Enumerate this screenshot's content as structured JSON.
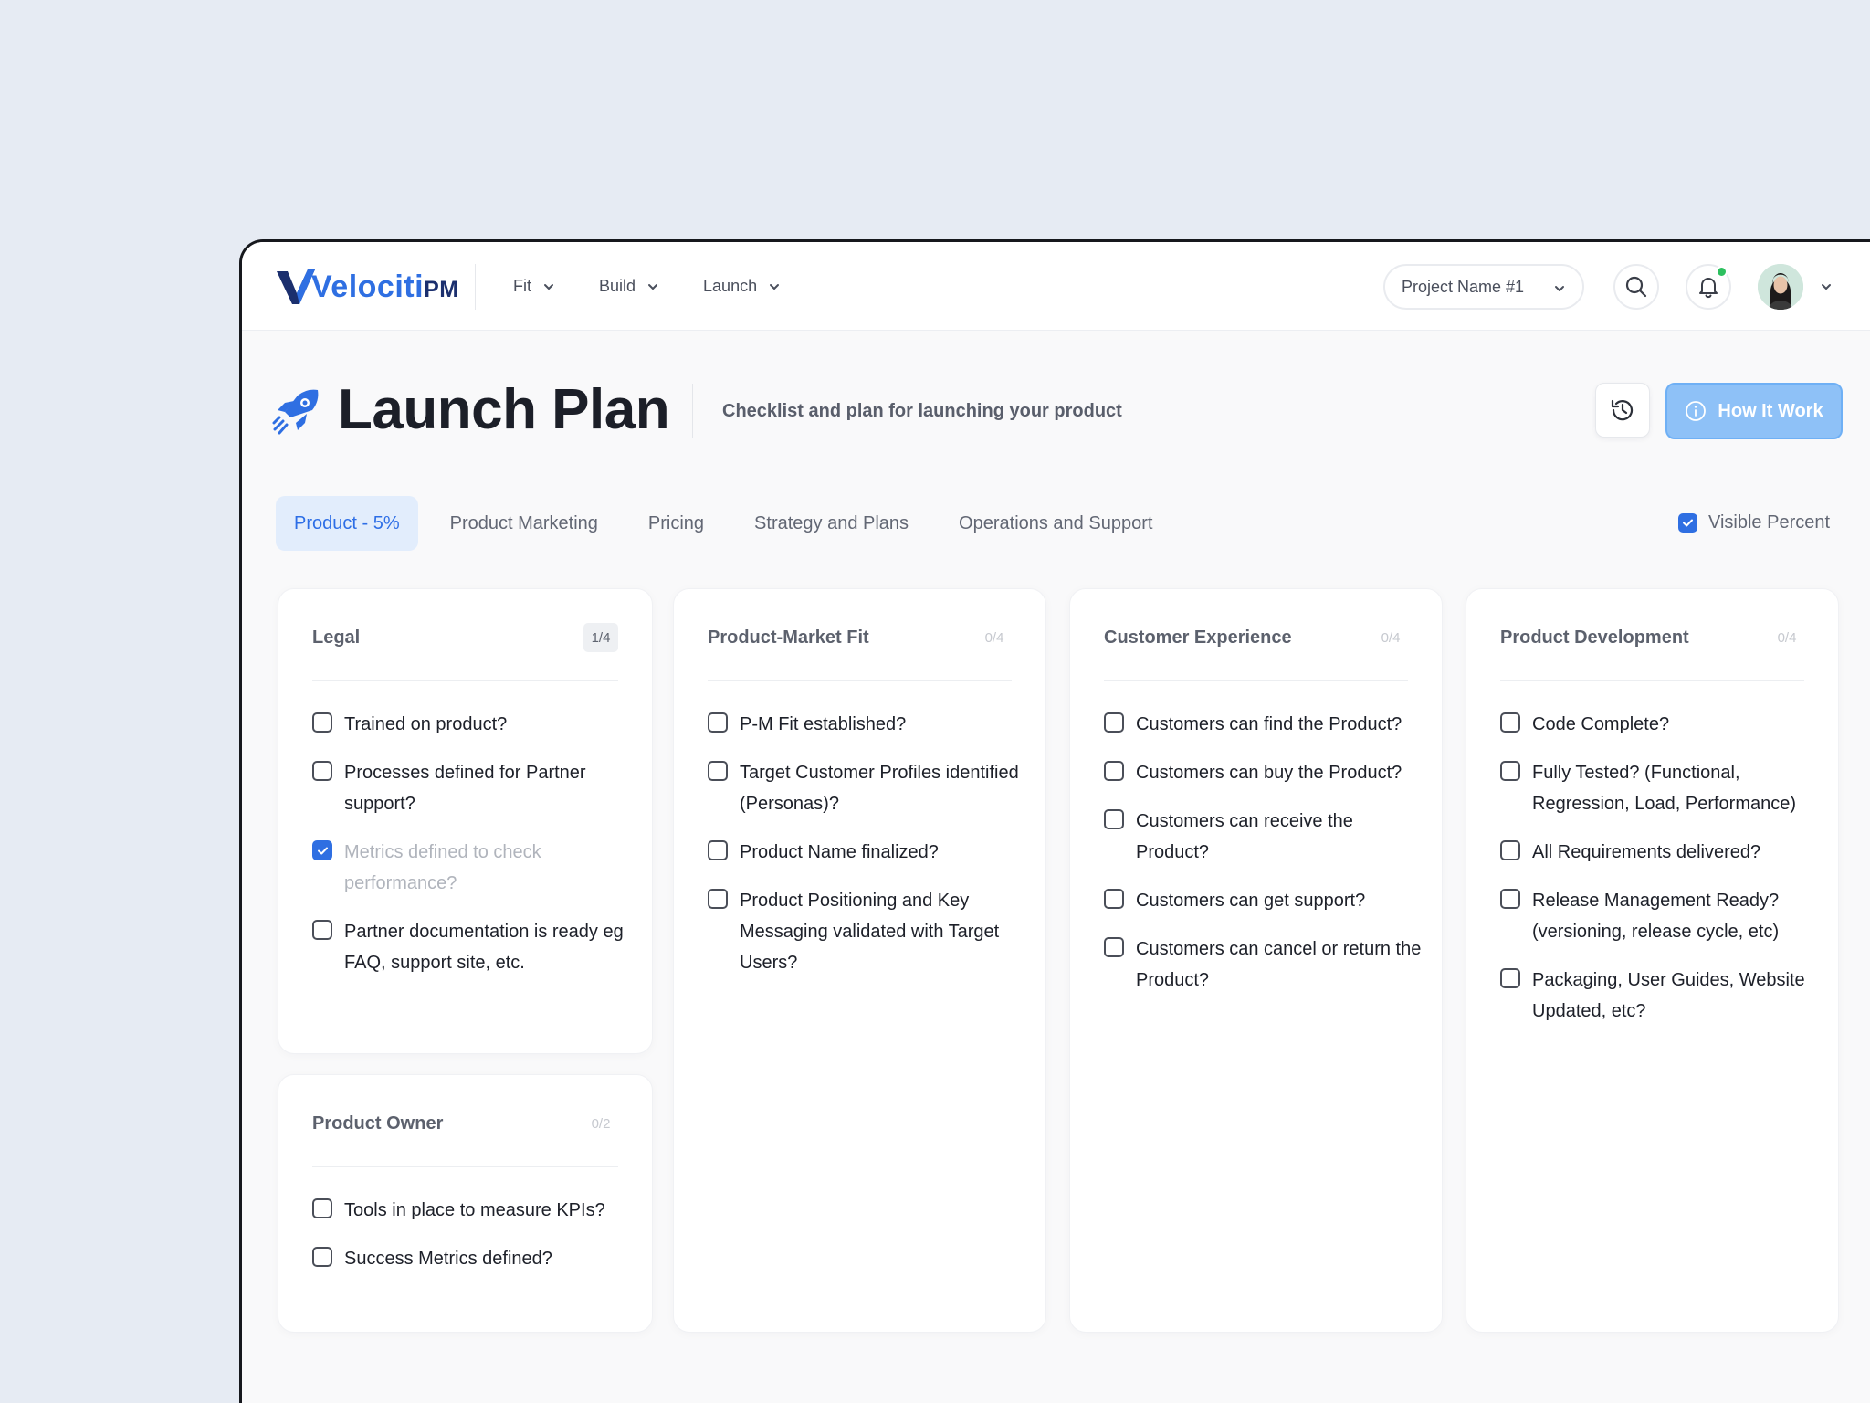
{
  "app": {
    "logo_text": "Velociti",
    "logo_suffix": "PM"
  },
  "topnav": [
    {
      "label": "Fit"
    },
    {
      "label": "Build"
    },
    {
      "label": "Launch"
    }
  ],
  "project_select": {
    "label": "Project Name #1"
  },
  "header": {
    "title": "Launch Plan",
    "subtitle": "Checklist and plan for launching your product",
    "how_button": "How It Work"
  },
  "tabs": [
    {
      "label": "Product - 5%",
      "active": true
    },
    {
      "label": "Product Marketing"
    },
    {
      "label": "Pricing"
    },
    {
      "label": "Strategy and Plans"
    },
    {
      "label": "Operations and Support"
    }
  ],
  "visible_percent": {
    "label": "Visible Percent",
    "checked": true
  },
  "colors": {
    "accent": "#2f6fe2",
    "button": "#8ec1f7",
    "notification": "#2dc05f"
  },
  "cards": {
    "legal": {
      "title": "Legal",
      "count": "1/4",
      "items": [
        {
          "text": "Trained on product?",
          "checked": false
        },
        {
          "text": "Processes defined for Partner support?",
          "checked": false
        },
        {
          "text": "Metrics defined to check performance?",
          "checked": true
        },
        {
          "text": "Partner documentation is ready eg FAQ, support site, etc.",
          "checked": false
        }
      ]
    },
    "owner": {
      "title": "Product Owner",
      "count": "0/2",
      "items": [
        {
          "text": "Tools in place to measure KPIs?",
          "checked": false
        },
        {
          "text": "Success Metrics defined?",
          "checked": false
        }
      ]
    },
    "pmfit": {
      "title": "Product-Market Fit",
      "count": "0/4",
      "items": [
        {
          "text": "P-M Fit established?",
          "checked": false
        },
        {
          "text": "Target Customer Profiles identified (Personas)?",
          "checked": false
        },
        {
          "text": "Product Name finalized?",
          "checked": false
        },
        {
          "text": "Product Positioning and Key Messaging validated with Target Users?",
          "checked": false
        }
      ]
    },
    "cx": {
      "title": "Customer Experience",
      "count": "0/4",
      "items": [
        {
          "text": "Customers can find the Product?",
          "checked": false
        },
        {
          "text": "Customers can buy the Product?",
          "checked": false
        },
        {
          "text": "Customers can receive the Product?",
          "checked": false
        },
        {
          "text": "Customers can get support?",
          "checked": false
        },
        {
          "text": "Customers can cancel or return the Product?",
          "checked": false
        }
      ]
    },
    "dev": {
      "title": "Product Development",
      "count": "0/4",
      "items": [
        {
          "text": "Code Complete?",
          "checked": false
        },
        {
          "text": "Fully Tested? (Functional, Regression, Load, Performance)",
          "checked": false
        },
        {
          "text": "All Requirements delivered?",
          "checked": false
        },
        {
          "text": "Release Management Ready? (versioning, release cycle, etc)",
          "checked": false
        },
        {
          "text": "Packaging, User Guides, Website Updated, etc?",
          "checked": false
        }
      ]
    }
  }
}
